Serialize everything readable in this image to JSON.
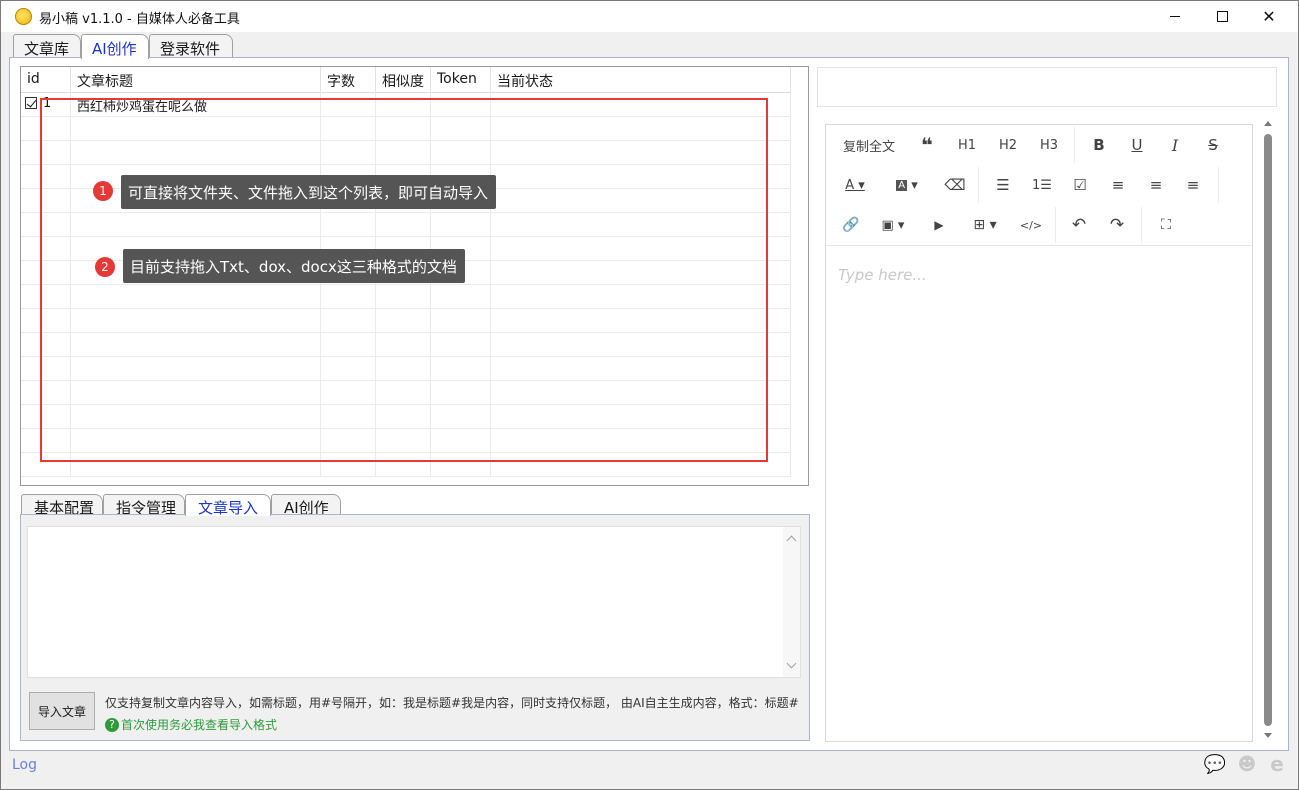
{
  "window": {
    "title": "易小稿 v1.1.0 - 自媒体人必备工具"
  },
  "top_tabs": [
    {
      "label": "文章库"
    },
    {
      "label": "AI创作"
    },
    {
      "label": "登录软件"
    }
  ],
  "grid": {
    "columns": [
      "id",
      "文章标题",
      "字数",
      "相似度",
      "Token",
      "当前状态"
    ],
    "rows": [
      {
        "id": "1",
        "title": "西红柿炒鸡蛋在呢么做",
        "words": "",
        "similarity": "",
        "token": "",
        "status": ""
      }
    ]
  },
  "tips": [
    {
      "num": "1",
      "text": "可直接将文件夹、文件拖入到这个列表，即可自动导入"
    },
    {
      "num": "2",
      "text": "目前支持拖入Txt、dox、docx这三种格式的文档"
    }
  ],
  "bottom_tabs": [
    {
      "label": "基本配置"
    },
    {
      "label": "指令管理"
    },
    {
      "label": "文章导入"
    },
    {
      "label": "AI创作"
    }
  ],
  "import": {
    "button_label": "导入文章",
    "hint": "仅支持复制文章内容导入，如需标题，用#号隔开，如：我是标题#我是内容，同时支持仅标题， 由AI自主生成内容，格式：标题#",
    "help_link": "首次使用务必我查看导入格式"
  },
  "editor": {
    "copy_all_label": "复制全文",
    "h1": "H1",
    "h2": "H2",
    "h3": "H3",
    "placeholder": "Type here..."
  },
  "statusbar": {
    "log_label": "Log"
  },
  "colors": {
    "accent_tab": "#1a36c8",
    "highlight_box": "#e53935",
    "help_green": "#2e9b3a"
  }
}
